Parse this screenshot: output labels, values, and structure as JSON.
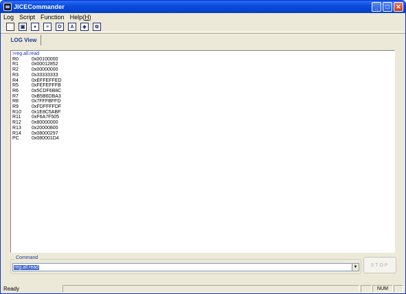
{
  "window": {
    "title": "JICECommander",
    "controls": {
      "minimize": "_",
      "maximize": "□",
      "close": "✕"
    }
  },
  "menu": [
    {
      "label": "Log"
    },
    {
      "label": "Script"
    },
    {
      "label": "Function"
    },
    {
      "label": "Help(",
      "accel": "H",
      "suffix": ")"
    }
  ],
  "toolbar": [
    {
      "icon": "new-icon",
      "glyph": ""
    },
    {
      "icon": "save-icon",
      "glyph": "▣"
    },
    {
      "icon": "target-icon",
      "glyph": "⌖"
    },
    {
      "icon": "list-icon",
      "glyph": "≡"
    },
    {
      "icon": "d-icon",
      "glyph": "D"
    },
    {
      "icon": "a-icon",
      "glyph": "A"
    },
    {
      "icon": "download-icon",
      "glyph": "◈"
    },
    {
      "icon": "window-icon",
      "glyph": "⧉"
    }
  ],
  "tab": {
    "label": "LOG View"
  },
  "log": {
    "command_line": ">reg.all.read",
    "registers": [
      {
        "name": "R0",
        "value": "0x00100000"
      },
      {
        "name": "R1",
        "value": "0x00012852"
      },
      {
        "name": "R2",
        "value": "0x00000000"
      },
      {
        "name": "R3",
        "value": "0x33333333"
      },
      {
        "name": "R4",
        "value": "0xEFFEFFED"
      },
      {
        "name": "R5",
        "value": "0xFEFEFFFB"
      },
      {
        "name": "R6",
        "value": "0x5CDF6B8C"
      },
      {
        "name": "R7",
        "value": "0xB5B6DBA3"
      },
      {
        "name": "R8",
        "value": "0x7FFFBFFD"
      },
      {
        "name": "R9",
        "value": "0xFDFFFFDF"
      },
      {
        "name": "R10",
        "value": "0x1E8C5ABF"
      },
      {
        "name": "R11",
        "value": "0xF6A7F505"
      },
      {
        "name": "R12",
        "value": "0x80000000"
      },
      {
        "name": "R13",
        "value": "0x20000800"
      },
      {
        "name": "R14",
        "value": "0x08000297"
      },
      {
        "name": "PC",
        "value": "0x080001D4"
      }
    ]
  },
  "command": {
    "label": "Command",
    "value": "reg.all.read",
    "dropdown_glyph": "▼"
  },
  "stop_button": {
    "label": "STOP"
  },
  "status": {
    "ready": "Ready",
    "num": "NUM"
  }
}
